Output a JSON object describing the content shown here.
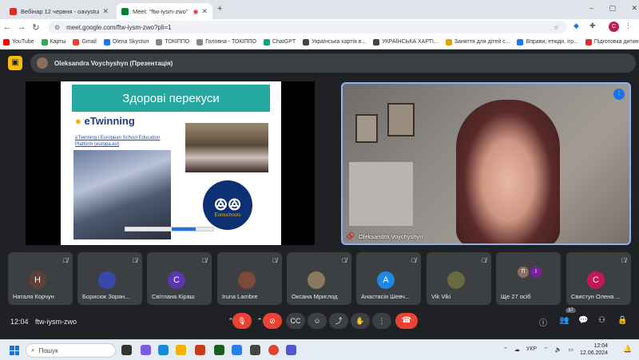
{
  "browser": {
    "tabs": [
      {
        "label": "Вебінар 12 червня - oavystun",
        "favicon_color": "#d93025"
      },
      {
        "label": "Meet: \"ftw-iysm-zwo\"",
        "favicon_color": "#00832d",
        "active": true
      }
    ],
    "new_tab": "+",
    "window_controls": [
      "–",
      "▢",
      "✕"
    ],
    "url": "meet.google.com/ftw-iysm-zwo?pli=1",
    "profile_initial": "С",
    "bookmarks": [
      {
        "label": "YouTube",
        "color": "#ff0000"
      },
      {
        "label": "Карты",
        "color": "#34a853"
      },
      {
        "label": "Gmail",
        "color": "#ea4335"
      },
      {
        "label": "Olena Skystun",
        "color": "#1877f2"
      },
      {
        "label": "ТОКІППО",
        "color": "#888888"
      },
      {
        "label": "Головна - ТОКІППО",
        "color": "#888888"
      },
      {
        "label": "ChatGPT",
        "color": "#10a37f"
      },
      {
        "label": "Українська хартія в...",
        "color": "#444444"
      },
      {
        "label": "УКРАЇНСЬКА ХАРТІ...",
        "color": "#444444"
      },
      {
        "label": "Заняття для дітей с...",
        "color": "#e8a200"
      },
      {
        "label": "Вправи, етюди, ігр...",
        "color": "#1877f2"
      },
      {
        "label": "Підготовка дитини...",
        "color": "#d93025"
      }
    ]
  },
  "meet": {
    "presenting_label": "Oleksandra Voychyshyn (Презентація)",
    "slide": {
      "title": "Здорові перекуси",
      "etwinning_brand": "eTwinning",
      "link_text": "eTwinning | European School Education Platform (europa.eu)",
      "logo_text": "Euroschools"
    },
    "speaker_name": "Oleksandra Voychyshyn",
    "tiles": [
      {
        "name": "Наталя Корчун",
        "initial": "Н",
        "color": "#5d4037"
      },
      {
        "name": "Борисюк Зорян...",
        "initial": "",
        "color": "#3949ab"
      },
      {
        "name": "Світлана Кіраш",
        "initial": "С",
        "color": "#5e35b1"
      },
      {
        "name": "Iruna Lambre",
        "initial": "",
        "color": "#7b4a3a"
      },
      {
        "name": "Оксана Мриглод",
        "initial": "",
        "color": "#8a7a60"
      },
      {
        "name": "Анастасія Шевч...",
        "initial": "А",
        "color": "#1e88e5"
      },
      {
        "name": "Vik Viki",
        "initial": "",
        "color": "#6a6a40"
      },
      {
        "name": "Ще 27 осіб",
        "initial": "",
        "color": "#3c4043"
      },
      {
        "name": "Свистун Олена ...",
        "initial": "С",
        "color": "#c2185b"
      }
    ],
    "more_avatars": [
      {
        "initial": "П",
        "color": "#8d6e63"
      },
      {
        "initial": "І",
        "color": "#7b1fa2"
      }
    ],
    "time": "12:04",
    "meeting_code": "ftw-iysm-zwo",
    "participant_count": "37"
  },
  "taskbar": {
    "search_placeholder": "Пошук",
    "lang": "УКР",
    "time": "12:04",
    "date": "12.06.2024"
  }
}
